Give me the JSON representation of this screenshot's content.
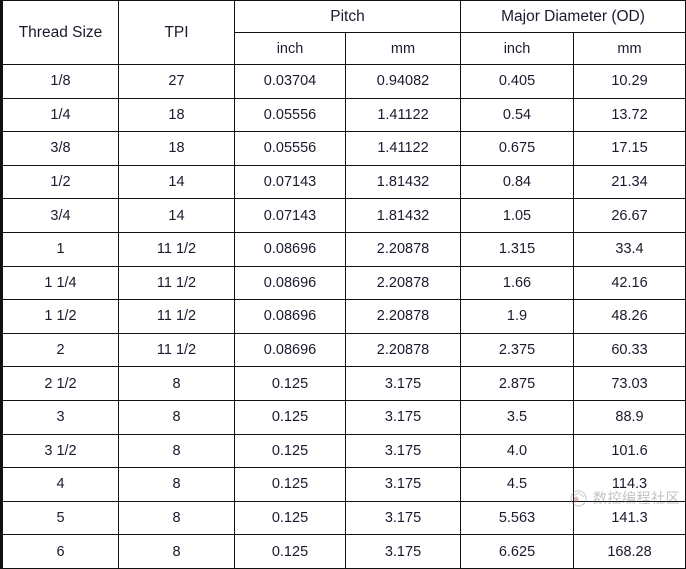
{
  "table": {
    "header": {
      "groups": [
        {
          "label": "Thread Size",
          "rowspan": 2
        },
        {
          "label": "TPI",
          "rowspan": 2
        },
        {
          "label": "Pitch",
          "colspan": 2
        },
        {
          "label": "Major Diameter (OD)",
          "colspan": 2
        }
      ],
      "subheaders": [
        "inch",
        "mm",
        "inch",
        "mm"
      ]
    },
    "columns": [
      "Thread Size",
      "TPI",
      "Pitch inch",
      "Pitch mm",
      "Major Diameter inch",
      "Major Diameter mm"
    ],
    "rows": [
      [
        "1/8",
        "27",
        "0.03704",
        "0.94082",
        "0.405",
        "10.29"
      ],
      [
        "1/4",
        "18",
        "0.05556",
        "1.41122",
        "0.54",
        "13.72"
      ],
      [
        "3/8",
        "18",
        "0.05556",
        "1.41122",
        "0.675",
        "17.15"
      ],
      [
        "1/2",
        "14",
        "0.07143",
        "1.81432",
        "0.84",
        "21.34"
      ],
      [
        "3/4",
        "14",
        "0.07143",
        "1.81432",
        "1.05",
        "26.67"
      ],
      [
        "1",
        "11 1/2",
        "0.08696",
        "2.20878",
        "1.315",
        "33.4"
      ],
      [
        "1 1/4",
        "11 1/2",
        "0.08696",
        "2.20878",
        "1.66",
        "42.16"
      ],
      [
        "1 1/2",
        "11 1/2",
        "0.08696",
        "2.20878",
        "1.9",
        "48.26"
      ],
      [
        "2",
        "11 1/2",
        "0.08696",
        "2.20878",
        "2.375",
        "60.33"
      ],
      [
        "2 1/2",
        "8",
        "0.125",
        "3.175",
        "2.875",
        "73.03"
      ],
      [
        "3",
        "8",
        "0.125",
        "3.175",
        "3.5",
        "88.9"
      ],
      [
        "3 1/2",
        "8",
        "0.125",
        "3.175",
        "4.0",
        "101.6"
      ],
      [
        "4",
        "8",
        "0.125",
        "3.175",
        "4.5",
        "114.3"
      ],
      [
        "5",
        "8",
        "0.125",
        "3.175",
        "5.563",
        "141.3"
      ],
      [
        "6",
        "8",
        "0.125",
        "3.175",
        "6.625",
        "168.28"
      ]
    ]
  },
  "watermark": {
    "text": "数控编程社区",
    "logo_icon": "circular-badge-icon"
  },
  "colors": {
    "text": "#1a1a2e",
    "border": "#111111",
    "background": "#ffffff",
    "watermark_text": "#6f6f78"
  }
}
